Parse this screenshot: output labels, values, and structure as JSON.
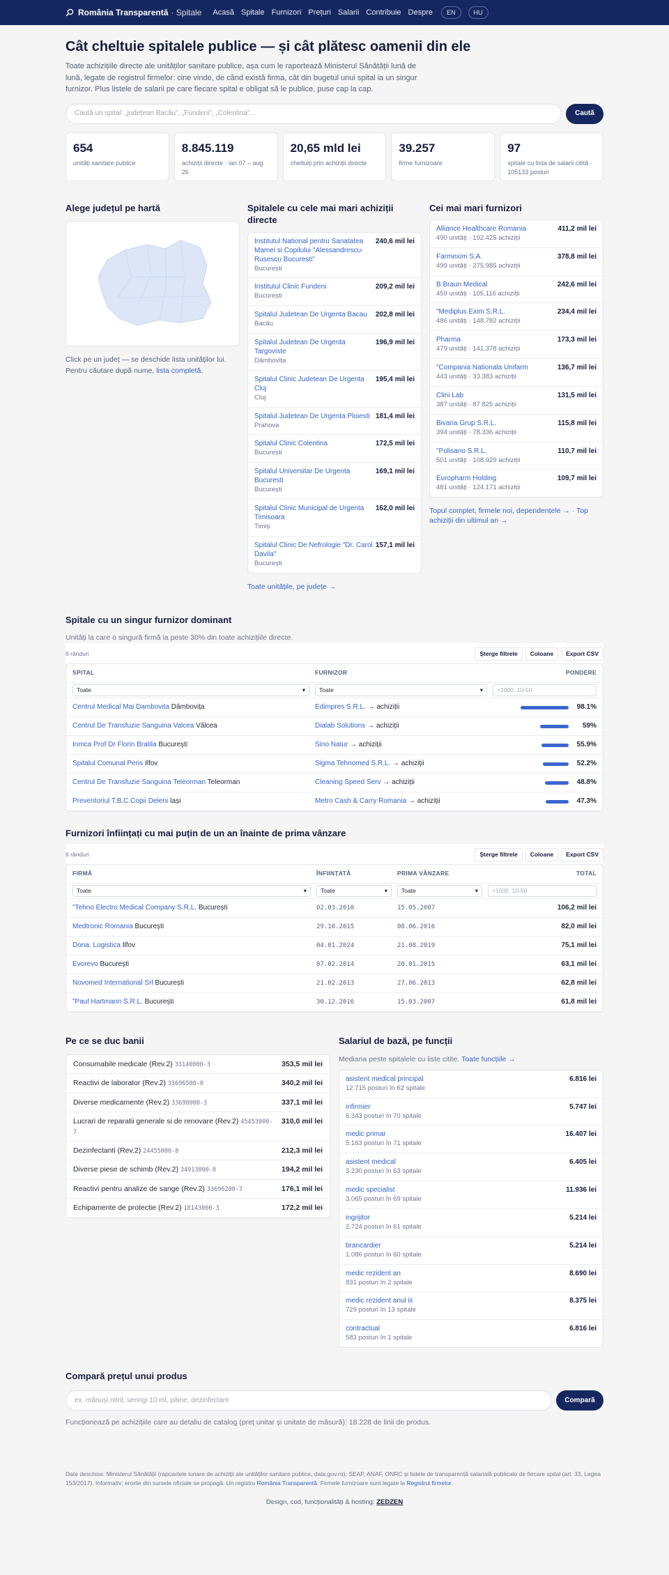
{
  "nav": {
    "brand": "România Transparentă",
    "site": "· Spitale",
    "links": [
      "Acasă",
      "Spitale",
      "Furnizori",
      "Prețuri",
      "Salarii",
      "Contribuie",
      "Despre"
    ],
    "langs": [
      "EN",
      "HU"
    ]
  },
  "hero": {
    "title": "Cât cheltuie spitalele publice — și cât plătesc oamenii din ele",
    "intro": "Toate achizițiile directe ale unităților sanitare publice, așa cum le raportează Ministerul Sănătății lună de lună, legate de registrul firmelor: cine vinde, de când există firma, cât din bugetul unui spital ia un singur furnizor. Plus listele de salarii pe care fiecare spital e obligat să le publice, puse cap la cap.",
    "search_placeholder": "Caută un spital: „județean Bacău”, „Fundeni”, „Colentina”…",
    "search_button": "Caută"
  },
  "stats": [
    {
      "value": "654",
      "label": "unități sanitare publice"
    },
    {
      "value": "8.845.119",
      "label": "achiziții directe · ian 07 – aug 26"
    },
    {
      "value": "20,65 mld lei",
      "label": "cheltuiți prin achiziții directe"
    },
    {
      "value": "39.257",
      "label": "firme furnizoare"
    },
    {
      "value": "97",
      "label": "spitale cu lista de salarii citită · 105133 posturi"
    }
  ],
  "map": {
    "title": "Alege județul pe hartă",
    "hint": "Click pe un județ — se deschide lista unităților lui. Pentru căutare după nume,",
    "hint_link": "lista completă",
    "hint_end": "."
  },
  "top_hospitals": {
    "title": "Spitalele cu cele mai mari achiziții directe",
    "items": [
      {
        "name": "Institutul National pentru Sanatatea Mamei si Copilului \"Alessandrescu-Rusescu Bucuresti\"",
        "city": "București",
        "amount": "240,6 mil lei"
      },
      {
        "name": "Institutul Clinic Fundeni",
        "city": "București",
        "amount": "209,2 mil lei"
      },
      {
        "name": "Spitalul Judetean De Urgenta Bacau",
        "city": "Bacău",
        "amount": "202,8 mil lei"
      },
      {
        "name": "Spitalul Judetean De Urgenta Targoviste",
        "city": "Dâmbovița",
        "amount": "196,9 mil lei"
      },
      {
        "name": "Spitalul Clinic Judetean De Urgenta Cluj",
        "city": "Cluj",
        "amount": "195,4 mil lei"
      },
      {
        "name": "Spitalul Judetean De Urgenta Ploiesti",
        "city": "Prahova",
        "amount": "181,4 mil lei"
      },
      {
        "name": "Spitalul Clinic Colentina",
        "city": "București",
        "amount": "172,5 mil lei"
      },
      {
        "name": "Spitalul Universitar De Urgenta Bucuresti",
        "city": "București",
        "amount": "169,1 mil lei"
      },
      {
        "name": "Spitalul Clinic Municipal de Urgenta Timisoara",
        "city": "Timiș",
        "amount": "162,0 mil lei"
      },
      {
        "name": "Spitalul Clinic De Nefrologie \"Dr. Carol Davila\"",
        "city": "București",
        "amount": "157,1 mil lei"
      }
    ],
    "link": "Toate unitățile, pe județe →"
  },
  "top_suppliers": {
    "title": "Cei mai mari furnizori",
    "items": [
      {
        "name": "Alliance Healthcare Romania",
        "sub": "490 unități · 192.425 achiziții",
        "amount": "411,2 mil lei"
      },
      {
        "name": "Farmexim S.A.",
        "sub": "499 unități · 275.985 achiziții",
        "amount": "378,8 mil lei"
      },
      {
        "name": "B.Braun Medical",
        "sub": "459 unități · 105.116 achiziții",
        "amount": "242,6 mil lei"
      },
      {
        "name": "\"Mediplus Exim S.R.L.",
        "sub": "486 unități · 148.782 achiziții",
        "amount": "234,4 mil lei"
      },
      {
        "name": "Pharma",
        "sub": "479 unități · 141.378 achiziții",
        "amount": "173,3 mil lei"
      },
      {
        "name": "\"Compania Nationala Unifarm",
        "sub": "443 unități · 33.383 achiziții",
        "amount": "136,7 mil lei"
      },
      {
        "name": "Clini Lab",
        "sub": "387 unități · 87.825 achiziții",
        "amount": "131,5 mil lei"
      },
      {
        "name": "Bivaria Grup S.R.L.",
        "sub": "394 unități · 78.336 achiziții",
        "amount": "115,8 mil lei"
      },
      {
        "name": "\"Polisano S.R.L.",
        "sub": "501 unități · 108.929 achiziții",
        "amount": "110,7 mil lei"
      },
      {
        "name": "Europharm Holding",
        "sub": "481 unități · 124.171 achiziții",
        "amount": "109,7 mil lei"
      }
    ],
    "link": "Topul complet, firmele noi, dependențele → · Top achiziții din ultimul an →"
  },
  "dominant": {
    "title": "Spitale cu un singur furnizor dominant",
    "desc": "Unități la care o singură firmă ia peste 30% din toate achizițiile directe.",
    "rows_count": "6 rânduri",
    "tools": [
      "Șterge filtrele",
      "Coloane",
      "Export CSV"
    ],
    "headers": [
      "SPITAL",
      "FURNIZOR",
      "PONDERE"
    ],
    "filter_all": "Toate",
    "num_placeholder": ">1000, 10-50",
    "rows": [
      {
        "hospital": "Centrul Medical Mai Dambovita",
        "county": "Dâmbovița",
        "supplier": "Edimpres S.R.L.",
        "suffix": "→ achiziții",
        "share": "98.1%",
        "pct": 98.1
      },
      {
        "hospital": "Centrul De Transfuzie Sanguina Valcea",
        "county": "Vâlcea",
        "supplier": "Dialab Solutions",
        "suffix": "→ achiziții",
        "share": "59%",
        "pct": 59
      },
      {
        "hospital": "Inmca Prof Dr Florin Bratila",
        "county": "București",
        "supplier": "Sino Natur",
        "suffix": "→ achiziții",
        "share": "55.9%",
        "pct": 55.9
      },
      {
        "hospital": "Spitalul Comunal Peris",
        "county": "Ilfov",
        "supplier": "Sigma Tehnomed S.R.L.",
        "suffix": "→ achiziții",
        "share": "52.2%",
        "pct": 52.2
      },
      {
        "hospital": "Centrul De Transfuzie Sanguina Teleorman",
        "county": "Teleorman",
        "supplier": "Cleaning Speed Serv",
        "suffix": "→ achiziții",
        "share": "48.8%",
        "pct": 48.8
      },
      {
        "hospital": "Preventoriul T.B.C.Copii Deleni",
        "county": "Iași",
        "supplier": "Metro Cash & Carry Romania",
        "suffix": "→ achiziții",
        "share": "47.3%",
        "pct": 47.3
      }
    ]
  },
  "newfirms": {
    "title": "Furnizori înființați cu mai puțin de un an înainte de prima vânzare",
    "rows_count": "6 rânduri",
    "tools": [
      "Șterge filtrele",
      "Coloane",
      "Export CSV"
    ],
    "headers": [
      "FIRMĂ",
      "ÎNFIINȚATĂ",
      "PRIMA VÂNZARE",
      "TOTAL"
    ],
    "filter_all": "Toate",
    "num_placeholder": ">1000, 10-50",
    "rows": [
      {
        "firm": "\"Tehno Electro Medical Company S.R.L.",
        "city": "București",
        "founded": "02.03.2010",
        "first": "15.05.2007",
        "total": "106,2 mil lei"
      },
      {
        "firm": "Medtronic Romania",
        "city": "București",
        "founded": "29.10.2015",
        "first": "08.06.2016",
        "total": "82,0 mil lei"
      },
      {
        "firm": "Dona. Logistica",
        "city": "Ilfov",
        "founded": "04.01.2024",
        "first": "21.08.2019",
        "total": "75,1 mil lei"
      },
      {
        "firm": "Evorevo",
        "city": "București",
        "founded": "07.02.2014",
        "first": "20.01.2015",
        "total": "63,1 mil lei"
      },
      {
        "firm": "Novomed International Srl",
        "city": "București",
        "founded": "21.02.2013",
        "first": "27.06.2013",
        "total": "62,8 mil lei"
      },
      {
        "firm": "\"Paul Hartmann S.R.L.",
        "city": "București",
        "founded": "30.12.2016",
        "first": "15.03.2007",
        "total": "61,8 mil lei"
      }
    ]
  },
  "money": {
    "title": "Pe ce se duc banii",
    "items": [
      {
        "name": "Consumabile medicale (Rev.2)",
        "code": "33140000-3",
        "amount": "353,5 mil lei"
      },
      {
        "name": "Reactivi de laborator (Rev.2)",
        "code": "33696500-0",
        "amount": "340,2 mil lei"
      },
      {
        "name": "Diverse medicamente (Rev.2)",
        "code": "33690000-3",
        "amount": "337,1 mil lei"
      },
      {
        "name": "Lucrari de reparatii generale si de renovare (Rev.2)",
        "code": "45453000-7",
        "amount": "310,0 mil lei"
      },
      {
        "name": "Dezinfectanti (Rev.2)",
        "code": "24455000-8",
        "amount": "212,3 mil lei"
      },
      {
        "name": "Diverse piese de schimb (Rev.2)",
        "code": "34913000-0",
        "amount": "194,2 mil lei"
      },
      {
        "name": "Reactivi pentru analize de sange (Rev.2)",
        "code": "33696200-7",
        "amount": "176,1 mil lei"
      },
      {
        "name": "Echipamente de protectie (Rev.2)",
        "code": "18143000-3",
        "amount": "172,2 mil lei"
      }
    ]
  },
  "salaries": {
    "title": "Salariul de bază, pe funcții",
    "desc": "Mediana peste spitalele cu liste citite.",
    "desc_link": "Toate funcțiile →",
    "items": [
      {
        "name": "asistent medical principal",
        "sub": "12.715 posturi în 62 spitale",
        "amount": "6.816 lei"
      },
      {
        "name": "infirmier",
        "sub": "6.343 posturi în 70 spitale",
        "amount": "5.747 lei"
      },
      {
        "name": "medic primar",
        "sub": "5.163 posturi în 71 spitale",
        "amount": "16.407 lei"
      },
      {
        "name": "asistent medical",
        "sub": "3.230 posturi în 63 spitale",
        "amount": "6.405 lei"
      },
      {
        "name": "medic specialist",
        "sub": "3.065 posturi în 69 spitale",
        "amount": "11.936 lei"
      },
      {
        "name": "ingrijitor",
        "sub": "2.724 posturi în 61 spitale",
        "amount": "5.214 lei"
      },
      {
        "name": "brancardier",
        "sub": "1.086 posturi în 60 spitale",
        "amount": "5.214 lei"
      },
      {
        "name": "medic rezident an",
        "sub": "831 posturi în 2 spitale",
        "amount": "8.690 lei"
      },
      {
        "name": "medic rezident anul iii",
        "sub": "729 posturi în 13 spitale",
        "amount": "8.375 lei"
      },
      {
        "name": "contractual",
        "sub": "583 posturi în 1 spitale",
        "amount": "6.816 lei"
      }
    ]
  },
  "compare": {
    "title": "Compară prețul unui produs",
    "placeholder": "ex. mănuși nitril, seringi 10 ml, pâine, dezinfectant",
    "button": "Compară",
    "note": "Funcționează pe achizițiile care au detaliu de catalog (preț unitar și unitate de măsură): 18.228 de linii de produs."
  },
  "footer": {
    "text": "Date deschise: Ministerul Sănătății (rapoartele lunare de achiziții ale unităților sanitare publice, data.gov.ro), SEAP, ANAF, ONRC și listele de transparență salarială publicate de fiecare spital (art. 33, Legea 153/2017). Informativ; erorile din sursele oficiale se propagă. Un registru",
    "link1": "România Transparentă",
    "mid": ". Firmele furnizoare sunt legate la",
    "link2": "Registrul firmelor",
    "end": ".",
    "credit": "Design, cod, funcționalități & hosting:",
    "credit_brand": "ZEDZEN"
  },
  "colors": {
    "navy": "#16275f",
    "link": "#3563c7",
    "bar": "#3a66cf"
  },
  "icons": {
    "nav": "search-icon",
    "chevron": "chevron-down-icon"
  }
}
